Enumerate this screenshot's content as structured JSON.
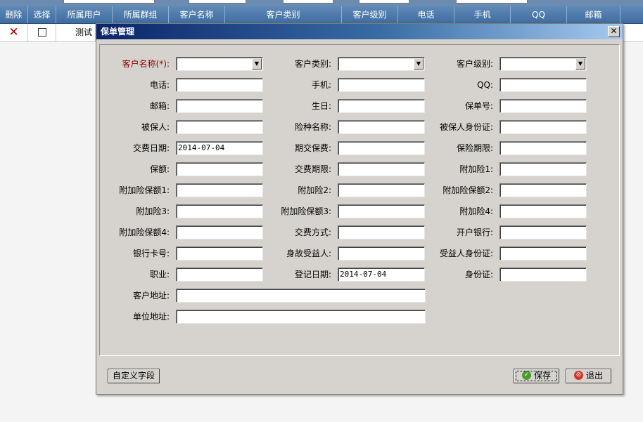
{
  "grid": {
    "headers": [
      "删除",
      "选择",
      "所属用户",
      "所属群组",
      "客户名称",
      "客户类别",
      "客户级别",
      "电话",
      "手机",
      "QQ",
      "邮箱"
    ],
    "row": {
      "user": "测试"
    }
  },
  "dialog": {
    "title": "保单管理",
    "close_label": "✕",
    "fields": {
      "customer_name": {
        "label": "客户名称(*):",
        "value": ""
      },
      "customer_type": {
        "label": "客户类别:",
        "value": ""
      },
      "customer_level": {
        "label": "客户级别:",
        "value": ""
      },
      "phone": {
        "label": "电话:",
        "value": ""
      },
      "mobile": {
        "label": "手机:",
        "value": ""
      },
      "qq": {
        "label": "QQ:",
        "value": ""
      },
      "email": {
        "label": "邮箱:",
        "value": ""
      },
      "birthday": {
        "label": "生日:",
        "value": ""
      },
      "policy_no": {
        "label": "保单号:",
        "value": ""
      },
      "insured": {
        "label": "被保人:",
        "value": ""
      },
      "insurance_name": {
        "label": "险种名称:",
        "value": ""
      },
      "insured_id": {
        "label": "被保人身份证:",
        "value": ""
      },
      "pay_date": {
        "label": "交费日期:",
        "value": "2014-07-04"
      },
      "period_premium": {
        "label": "期交保费:",
        "value": ""
      },
      "insurance_term": {
        "label": "保险期限:",
        "value": ""
      },
      "amount": {
        "label": "保额:",
        "value": ""
      },
      "pay_term": {
        "label": "交费期限:",
        "value": ""
      },
      "rider1": {
        "label": "附加险1:",
        "value": ""
      },
      "rider_amount1": {
        "label": "附加险保额1:",
        "value": ""
      },
      "rider2": {
        "label": "附加险2:",
        "value": ""
      },
      "rider_amount2": {
        "label": "附加险保额2:",
        "value": ""
      },
      "rider3": {
        "label": "附加险3:",
        "value": ""
      },
      "rider_amount3": {
        "label": "附加险保额3:",
        "value": ""
      },
      "rider4": {
        "label": "附加险4:",
        "value": ""
      },
      "rider_amount4": {
        "label": "附加险保额4:",
        "value": ""
      },
      "pay_method": {
        "label": "交费方式:",
        "value": ""
      },
      "bank": {
        "label": "开户银行:",
        "value": ""
      },
      "bank_card": {
        "label": "银行卡号:",
        "value": ""
      },
      "beneficiary": {
        "label": "身故受益人:",
        "value": ""
      },
      "beneficiary_id": {
        "label": "受益人身份证:",
        "value": ""
      },
      "occupation": {
        "label": "职业:",
        "value": ""
      },
      "register_date": {
        "label": "登记日期:",
        "value": "2014-07-04"
      },
      "id_card": {
        "label": "身份证:",
        "value": ""
      },
      "customer_address": {
        "label": "客户地址:",
        "value": ""
      },
      "work_address": {
        "label": "单位地址:",
        "value": ""
      }
    },
    "buttons": {
      "custom_fields": "自定义字段",
      "save": "保存",
      "exit": "退出"
    }
  }
}
